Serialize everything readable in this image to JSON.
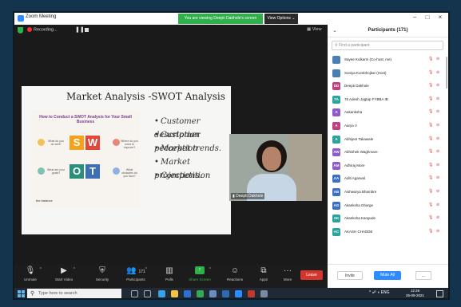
{
  "window": {
    "title": "Zoom Meeting",
    "viewing_banner": "You are viewing Deepti Dakhole's screen",
    "view_options": "View Options",
    "minimize": "−",
    "maximize": "□",
    "close": "×"
  },
  "meeting_bar": {
    "recording_label": "Recording...",
    "view_label": "View"
  },
  "slide": {
    "title": "Market Analysis -SWOT Analysis",
    "card_title": "How to Conduct a SWOT Analysis for Your Small Business",
    "swot_letters": [
      "S",
      "W",
      "O",
      "T"
    ],
    "swot_small_labels": [
      "What do you do well?",
      "Where do you need to improve?",
      "What are your goals?",
      "What obstacles do you face?"
    ],
    "brand": "the balance",
    "bullets": [
      "Customer description",
      "Customer perception",
      "Market trends.",
      "Market projections.",
      "Competition"
    ]
  },
  "video": {
    "participant_name": "Deepti Dakhole"
  },
  "toolbar": {
    "unmute": "Unmute",
    "start_video": "Start Video",
    "security": "Security",
    "participants": "Participants",
    "participants_count": "171",
    "polls": "Polls",
    "share_screen": "Share Screen",
    "reactions": "Reactions",
    "apps": "Apps",
    "more": "More",
    "leave": "Leave"
  },
  "participants_panel": {
    "title": "Participants (171)",
    "search_placeholder": "Find a participant",
    "participants": [
      {
        "initials": "",
        "name": "Sayee Kulkarni (Co-host, me)",
        "color": "#4a7fb5"
      },
      {
        "initials": "",
        "name": "Soniya Kumbhojkar (Host)",
        "color": "#4a7fb5"
      },
      {
        "initials": "DD",
        "name": "Deepti Dakhole",
        "color": "#c03f7d"
      },
      {
        "initials": "7A",
        "name": "76 Adesh Jagtap FYBBA IB",
        "color": "#2ea39a"
      },
      {
        "initials": "A",
        "name": "Aakanksha",
        "color": "#8e5cc9"
      },
      {
        "initials": "A",
        "name": "Aarya V",
        "color": "#c03f7d"
      },
      {
        "initials": "A",
        "name": "Abhijeet Takawale",
        "color": "#2ea39a"
      },
      {
        "initials": "AW",
        "name": "Abhishek Waghmare",
        "color": "#8e5cc9"
      },
      {
        "initials": "AM",
        "name": "Adhiraj More",
        "color": "#8e5cc9"
      },
      {
        "initials": "AA",
        "name": "Aditi Agarwal",
        "color": "#3a6fc4"
      },
      {
        "initials": "AB",
        "name": "Aishwarya Bhambre",
        "color": "#3a6fc4"
      },
      {
        "initials": "AG",
        "name": "Akanksha Gharge",
        "color": "#3a6fc4"
      },
      {
        "initials": "AK",
        "name": "Akanksha Kangude",
        "color": "#2ea39a"
      },
      {
        "initials": "AC",
        "name": "AKASH CHADDE",
        "color": "#2ea39a"
      }
    ],
    "invite": "Invite",
    "mute_all": "Mute All",
    "more": "..."
  },
  "taskbar": {
    "search_placeholder": "Type here to search",
    "tray_lang": "ENG",
    "time": "12:26",
    "date": "25-09-2021"
  }
}
